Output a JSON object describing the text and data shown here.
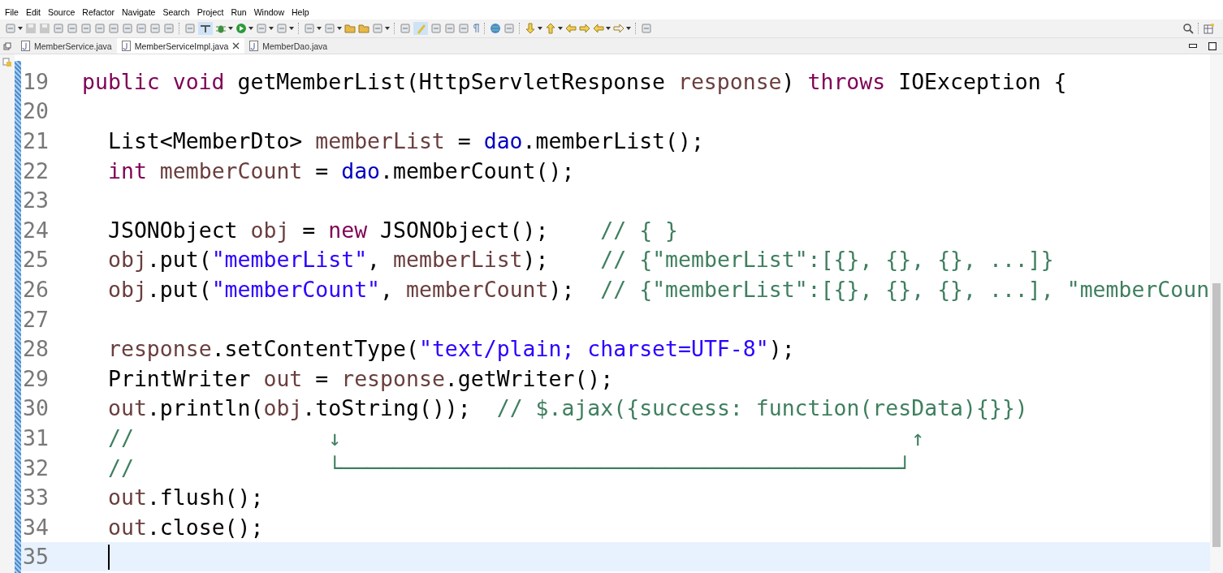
{
  "menu": [
    "File",
    "Edit",
    "Source",
    "Refactor",
    "Navigate",
    "Search",
    "Project",
    "Run",
    "Window",
    "Help"
  ],
  "tabs": [
    {
      "label": "MemberService.java",
      "selected": false,
      "closable": false
    },
    {
      "label": "MemberServiceImpl.java",
      "selected": true,
      "closable": true
    },
    {
      "label": "MemberDao.java",
      "selected": false,
      "closable": false
    }
  ],
  "editor": {
    "lines": [
      {
        "number": "19",
        "current": false,
        "indented": false,
        "tokens": [
          {
            "kind": "keyword",
            "text": "public"
          },
          {
            "kind": "keyword",
            "text": "void",
            "space": true
          },
          {
            "kind": "plain",
            "text": "getMemberList(HttpServletResponse",
            "space": true
          },
          {
            "kind": "local",
            "text": "response",
            "space": true
          },
          {
            "kind": "plain",
            "text": ")"
          },
          {
            "kind": "keyword",
            "text": "throws",
            "space": true
          },
          {
            "kind": "plain",
            "text": "IOException {",
            "space": true
          }
        ]
      },
      {
        "number": "20",
        "current": false
      },
      {
        "number": "21",
        "current": false,
        "indented": true,
        "tokens": [
          {
            "kind": "plain",
            "text": "List<MemberDto>"
          },
          {
            "kind": "local",
            "text": "memberList",
            "space": true
          },
          {
            "kind": "plain",
            "text": " = "
          },
          {
            "kind": "field",
            "text": "dao"
          },
          {
            "kind": "plain",
            "text": ".memberList();"
          }
        ]
      },
      {
        "number": "22",
        "current": false,
        "indented": true,
        "tokens": [
          {
            "kind": "keyword",
            "text": "int"
          },
          {
            "kind": "local",
            "text": "memberCount",
            "space": true
          },
          {
            "kind": "plain",
            "text": " = "
          },
          {
            "kind": "field",
            "text": "dao"
          },
          {
            "kind": "plain",
            "text": ".memberCount();"
          }
        ]
      },
      {
        "number": "23",
        "current": false
      },
      {
        "number": "24",
        "current": false,
        "indented": true,
        "tokens": [
          {
            "kind": "plain",
            "text": "JSONObject "
          },
          {
            "kind": "local",
            "text": "obj"
          },
          {
            "kind": "plain",
            "text": " = "
          },
          {
            "kind": "keyword",
            "text": "new"
          },
          {
            "kind": "plain",
            "text": " JSONObject();    "
          },
          {
            "kind": "comment",
            "text": "// { }"
          }
        ]
      },
      {
        "number": "25",
        "current": false,
        "indented": true,
        "tokens": [
          {
            "kind": "local",
            "text": "obj"
          },
          {
            "kind": "plain",
            "text": ".put("
          },
          {
            "kind": "string",
            "text": "\"memberList\""
          },
          {
            "kind": "plain",
            "text": ", "
          },
          {
            "kind": "local",
            "text": "memberList"
          },
          {
            "kind": "plain",
            "text": ");    "
          },
          {
            "kind": "comment",
            "text": "// {\"memberList\":[{}, {}, {}, ...]}"
          }
        ]
      },
      {
        "number": "26",
        "current": false,
        "indented": true,
        "tokens": [
          {
            "kind": "local",
            "text": "obj"
          },
          {
            "kind": "plain",
            "text": ".put("
          },
          {
            "kind": "string",
            "text": "\"memberCount\""
          },
          {
            "kind": "plain",
            "text": ", "
          },
          {
            "kind": "local",
            "text": "memberCount"
          },
          {
            "kind": "plain",
            "text": ");  "
          },
          {
            "kind": "comment",
            "text": "// {\"memberList\":[{}, {}, {}, ...], \"memberCoun"
          }
        ]
      },
      {
        "number": "27",
        "current": false
      },
      {
        "number": "28",
        "current": false,
        "indented": true,
        "tokens": [
          {
            "kind": "local",
            "text": "response"
          },
          {
            "kind": "plain",
            "text": ".setContentType("
          },
          {
            "kind": "string",
            "text": "\"text/plain; charset=UTF-8\""
          },
          {
            "kind": "plain",
            "text": ");"
          }
        ]
      },
      {
        "number": "29",
        "current": false,
        "indented": true,
        "tokens": [
          {
            "kind": "plain",
            "text": "PrintWriter"
          },
          {
            "kind": "local",
            "text": "out",
            "space": true
          },
          {
            "kind": "plain",
            "text": " = "
          },
          {
            "kind": "local",
            "text": "response"
          },
          {
            "kind": "plain",
            "text": ".getWriter();"
          }
        ]
      },
      {
        "number": "30",
        "current": false,
        "indented": true,
        "tokens": [
          {
            "kind": "local",
            "text": "out"
          },
          {
            "kind": "plain",
            "text": ".println("
          },
          {
            "kind": "local",
            "text": "obj"
          },
          {
            "kind": "plain",
            "text": ".toString());  "
          },
          {
            "kind": "comment",
            "text": "// $.ajax({success: function(resData){}})"
          }
        ]
      },
      {
        "number": "31",
        "current": false,
        "indented": true,
        "tokens": [
          {
            "kind": "comment",
            "text": "//               ↓                                            ↑"
          }
        ]
      },
      {
        "number": "32",
        "current": false,
        "indented": true,
        "tokens": [
          {
            "kind": "comment",
            "text": "//               └───────────────────────────────────────────┘"
          }
        ]
      },
      {
        "number": "33",
        "current": false,
        "indented": true,
        "tokens": [
          {
            "kind": "local",
            "text": "out"
          },
          {
            "kind": "plain",
            "text": ".flush();"
          }
        ]
      },
      {
        "number": "34",
        "current": false,
        "indented": true,
        "tokens": [
          {
            "kind": "local",
            "text": "out"
          },
          {
            "kind": "plain",
            "text": ".close();"
          }
        ]
      },
      {
        "number": "35",
        "current": true,
        "indented": true
      }
    ]
  }
}
